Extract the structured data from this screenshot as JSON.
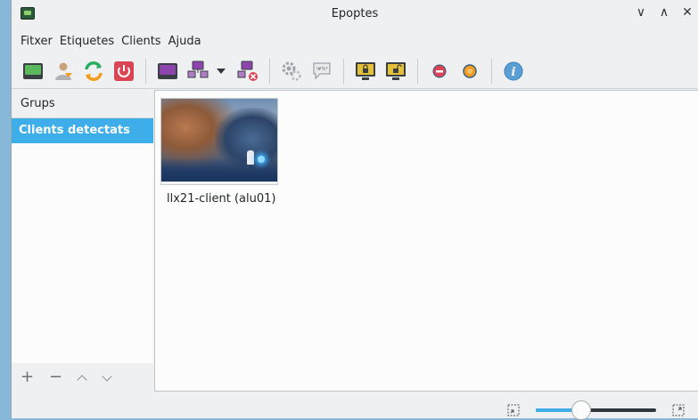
{
  "window": {
    "title": "Epoptes"
  },
  "menu": {
    "items": [
      "Fitxer",
      "Etiquetes",
      "Clients",
      "Ajuda"
    ]
  },
  "toolbar": {
    "buttons": [
      {
        "name": "wake-on-lan-icon"
      },
      {
        "name": "user-login-icon"
      },
      {
        "name": "reboot-icon"
      },
      {
        "name": "shutdown-icon"
      },
      {
        "name": "remote-support-icon"
      },
      {
        "name": "broadcast-screen-icon"
      },
      {
        "name": "stop-broadcast-icon"
      },
      {
        "name": "execute-command-icon"
      },
      {
        "name": "send-message-icon"
      },
      {
        "name": "lock-screen-icon"
      },
      {
        "name": "unlock-screen-icon"
      },
      {
        "name": "mute-sound-icon"
      },
      {
        "name": "unmute-sound-icon"
      },
      {
        "name": "about-info-icon"
      }
    ]
  },
  "sidebar": {
    "header": "Grups",
    "items": [
      {
        "label": "Clients detectats",
        "selected": true
      }
    ],
    "footer": {
      "add": "+",
      "remove": "−"
    }
  },
  "clients": [
    {
      "label": "llx21-client (alu01)"
    }
  ],
  "statusbar": {
    "zoom_level": 0.38
  },
  "colors": {
    "accent": "#3daee9",
    "background": "#eff0f1",
    "view": "#fcfcfc"
  }
}
